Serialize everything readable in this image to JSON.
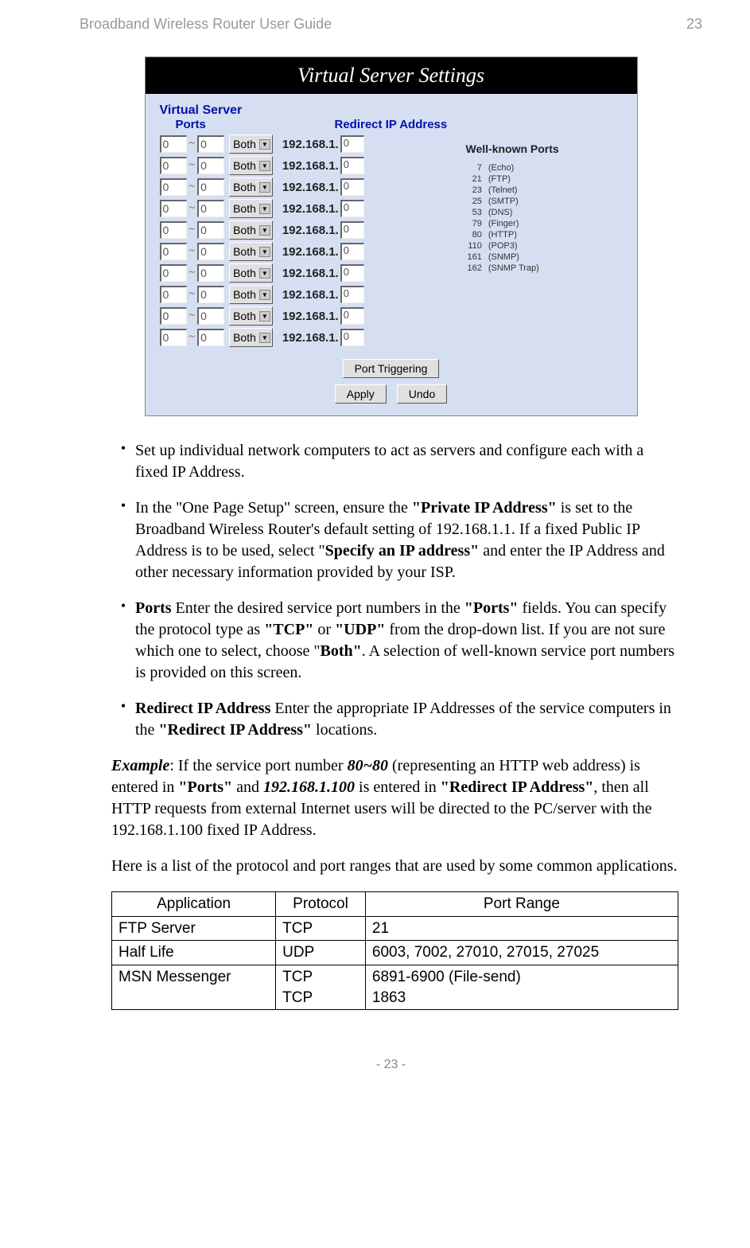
{
  "header": {
    "left": "Broadband Wireless Router User Guide",
    "right": "23"
  },
  "screenshot": {
    "title": "Virtual Server Settings",
    "section_label": "Virtual Server",
    "col_ports": "Ports",
    "col_redirect": "Redirect IP Address",
    "row_default": {
      "port_from": "0",
      "port_to": "0",
      "proto": "Both",
      "ip_prefix": "192.168.1.",
      "ip_last": "0"
    },
    "wkp_title": "Well-known Ports",
    "wkp_list": [
      {
        "port": "7",
        "name": "(Echo)"
      },
      {
        "port": "21",
        "name": "(FTP)"
      },
      {
        "port": "23",
        "name": "(Telnet)"
      },
      {
        "port": "25",
        "name": "(SMTP)"
      },
      {
        "port": "53",
        "name": "(DNS)"
      },
      {
        "port": "79",
        "name": "(Finger)"
      },
      {
        "port": "80",
        "name": "(HTTP)"
      },
      {
        "port": "110",
        "name": "(POP3)"
      },
      {
        "port": "161",
        "name": "(SNMP)"
      },
      {
        "port": "162",
        "name": "(SNMP Trap)"
      }
    ],
    "btn_port_trig": "Port Triggering",
    "btn_apply": "Apply",
    "btn_undo": "Undo"
  },
  "bullets": {
    "b1": "Set up individual network computers to act as servers and configure each with a fixed IP Address.",
    "b2_a": "In the \"One Page Setup\" screen, ensure the ",
    "b2_b": "\"Private IP Address\"",
    "b2_c": " is set to the Broadband Wireless Router's default setting of 192.168.1.1. If a fixed Public IP Address is to be used, select \"",
    "b2_d": "Specify an IP address\"",
    "b2_e": " and enter the IP Address and other necessary information provided by your ISP.",
    "b3_a": "Ports",
    "b3_b": " Enter the desired service port numbers in the ",
    "b3_c": "\"Ports\"",
    "b3_d": " fields. You can specify the protocol type as ",
    "b3_e": "\"TCP\"",
    "b3_f": " or ",
    "b3_g": "\"UDP\"",
    "b3_h": " from the drop-down list. If you are not sure which one to select, choose \"",
    "b3_i": "Both\"",
    "b3_j": ". A selection of well-known service port numbers is provided on this screen.",
    "b4_a": "Redirect IP Address",
    "b4_b": " Enter the appropriate IP Addresses of the service computers in the ",
    "b4_c": "\"Redirect IP Address\"",
    "b4_d": " locations."
  },
  "example": {
    "a": "Example",
    "b": ": If the service port number ",
    "c": "80~80",
    "d": " (representing an HTTP web address) is entered in ",
    "e": "\"Ports\"",
    "f": " and ",
    "g": "192.168.1.100",
    "h": " is entered in ",
    "i": "\"Redirect IP Address\"",
    "j": ", then all HTTP requests from external Internet users will be directed to the PC/server with the 192.168.1.100 fixed IP Address."
  },
  "para_intro": "Here is a list of the protocol and port ranges that are used by some common applications.",
  "table": {
    "h1": "Application",
    "h2": "Protocol",
    "h3": "Port Range",
    "rows": [
      {
        "app": "FTP Server",
        "proto": "TCP",
        "range": "21"
      },
      {
        "app": "Half Life",
        "proto": "UDP",
        "range": "6003, 7002, 27010, 27015, 27025"
      },
      {
        "app": "MSN Messenger",
        "proto": "TCP\nTCP",
        "range": "6891-6900 (File-send)\n1863"
      }
    ]
  },
  "footer": "- 23 -"
}
